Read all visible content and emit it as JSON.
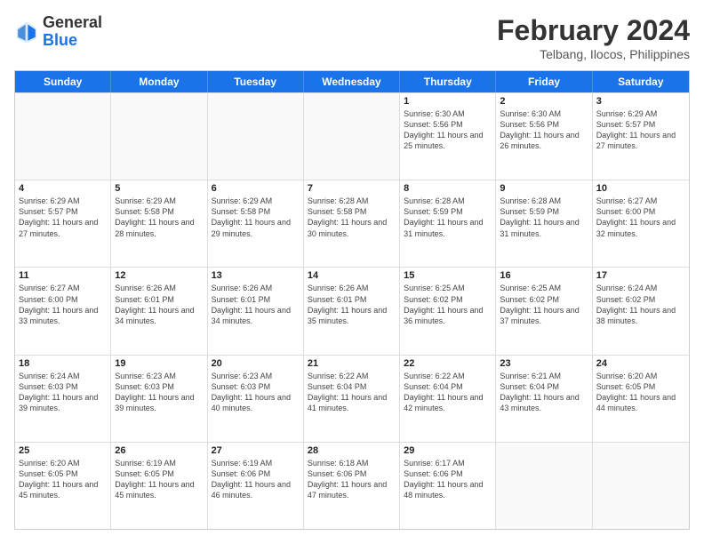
{
  "logo": {
    "general": "General",
    "blue": "Blue"
  },
  "title": "February 2024",
  "location": "Telbang, Ilocos, Philippines",
  "header": {
    "days": [
      "Sunday",
      "Monday",
      "Tuesday",
      "Wednesday",
      "Thursday",
      "Friday",
      "Saturday"
    ]
  },
  "weeks": [
    [
      {
        "day": "",
        "info": ""
      },
      {
        "day": "",
        "info": ""
      },
      {
        "day": "",
        "info": ""
      },
      {
        "day": "",
        "info": ""
      },
      {
        "day": "1",
        "info": "Sunrise: 6:30 AM\nSunset: 5:56 PM\nDaylight: 11 hours and 25 minutes."
      },
      {
        "day": "2",
        "info": "Sunrise: 6:30 AM\nSunset: 5:56 PM\nDaylight: 11 hours and 26 minutes."
      },
      {
        "day": "3",
        "info": "Sunrise: 6:29 AM\nSunset: 5:57 PM\nDaylight: 11 hours and 27 minutes."
      }
    ],
    [
      {
        "day": "4",
        "info": "Sunrise: 6:29 AM\nSunset: 5:57 PM\nDaylight: 11 hours and 27 minutes."
      },
      {
        "day": "5",
        "info": "Sunrise: 6:29 AM\nSunset: 5:58 PM\nDaylight: 11 hours and 28 minutes."
      },
      {
        "day": "6",
        "info": "Sunrise: 6:29 AM\nSunset: 5:58 PM\nDaylight: 11 hours and 29 minutes."
      },
      {
        "day": "7",
        "info": "Sunrise: 6:28 AM\nSunset: 5:58 PM\nDaylight: 11 hours and 30 minutes."
      },
      {
        "day": "8",
        "info": "Sunrise: 6:28 AM\nSunset: 5:59 PM\nDaylight: 11 hours and 31 minutes."
      },
      {
        "day": "9",
        "info": "Sunrise: 6:28 AM\nSunset: 5:59 PM\nDaylight: 11 hours and 31 minutes."
      },
      {
        "day": "10",
        "info": "Sunrise: 6:27 AM\nSunset: 6:00 PM\nDaylight: 11 hours and 32 minutes."
      }
    ],
    [
      {
        "day": "11",
        "info": "Sunrise: 6:27 AM\nSunset: 6:00 PM\nDaylight: 11 hours and 33 minutes."
      },
      {
        "day": "12",
        "info": "Sunrise: 6:26 AM\nSunset: 6:01 PM\nDaylight: 11 hours and 34 minutes."
      },
      {
        "day": "13",
        "info": "Sunrise: 6:26 AM\nSunset: 6:01 PM\nDaylight: 11 hours and 34 minutes."
      },
      {
        "day": "14",
        "info": "Sunrise: 6:26 AM\nSunset: 6:01 PM\nDaylight: 11 hours and 35 minutes."
      },
      {
        "day": "15",
        "info": "Sunrise: 6:25 AM\nSunset: 6:02 PM\nDaylight: 11 hours and 36 minutes."
      },
      {
        "day": "16",
        "info": "Sunrise: 6:25 AM\nSunset: 6:02 PM\nDaylight: 11 hours and 37 minutes."
      },
      {
        "day": "17",
        "info": "Sunrise: 6:24 AM\nSunset: 6:02 PM\nDaylight: 11 hours and 38 minutes."
      }
    ],
    [
      {
        "day": "18",
        "info": "Sunrise: 6:24 AM\nSunset: 6:03 PM\nDaylight: 11 hours and 39 minutes."
      },
      {
        "day": "19",
        "info": "Sunrise: 6:23 AM\nSunset: 6:03 PM\nDaylight: 11 hours and 39 minutes."
      },
      {
        "day": "20",
        "info": "Sunrise: 6:23 AM\nSunset: 6:03 PM\nDaylight: 11 hours and 40 minutes."
      },
      {
        "day": "21",
        "info": "Sunrise: 6:22 AM\nSunset: 6:04 PM\nDaylight: 11 hours and 41 minutes."
      },
      {
        "day": "22",
        "info": "Sunrise: 6:22 AM\nSunset: 6:04 PM\nDaylight: 11 hours and 42 minutes."
      },
      {
        "day": "23",
        "info": "Sunrise: 6:21 AM\nSunset: 6:04 PM\nDaylight: 11 hours and 43 minutes."
      },
      {
        "day": "24",
        "info": "Sunrise: 6:20 AM\nSunset: 6:05 PM\nDaylight: 11 hours and 44 minutes."
      }
    ],
    [
      {
        "day": "25",
        "info": "Sunrise: 6:20 AM\nSunset: 6:05 PM\nDaylight: 11 hours and 45 minutes."
      },
      {
        "day": "26",
        "info": "Sunrise: 6:19 AM\nSunset: 6:05 PM\nDaylight: 11 hours and 45 minutes."
      },
      {
        "day": "27",
        "info": "Sunrise: 6:19 AM\nSunset: 6:06 PM\nDaylight: 11 hours and 46 minutes."
      },
      {
        "day": "28",
        "info": "Sunrise: 6:18 AM\nSunset: 6:06 PM\nDaylight: 11 hours and 47 minutes."
      },
      {
        "day": "29",
        "info": "Sunrise: 6:17 AM\nSunset: 6:06 PM\nDaylight: 11 hours and 48 minutes."
      },
      {
        "day": "",
        "info": ""
      },
      {
        "day": "",
        "info": ""
      }
    ]
  ]
}
